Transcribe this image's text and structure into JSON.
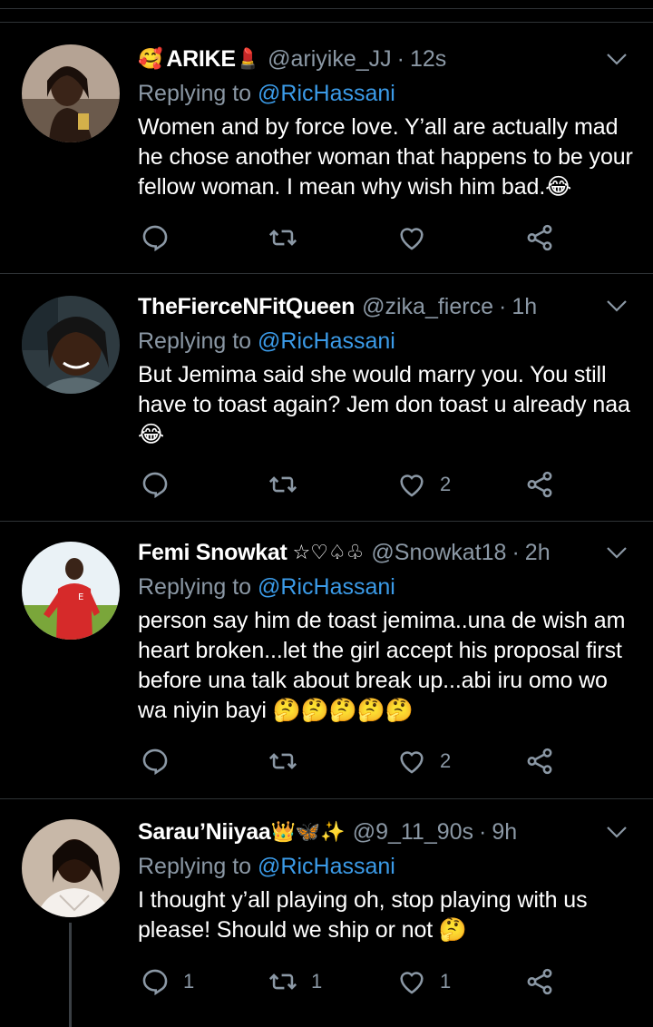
{
  "colors": {
    "background": "#000000",
    "text": "#ffffff",
    "muted": "#8b98a5",
    "link": "#3b9be8",
    "divider": "#2f3336"
  },
  "tweets": [
    {
      "name_prefix_emoji": "🥰",
      "name": "ARIKE",
      "name_suffix_emoji": "💄",
      "handle": "@ariyike_JJ",
      "time": "12s",
      "replying_label": "Replying to",
      "replying_to": "@RicHassani",
      "text": "Women and by force love. Y’all are actually mad he chose another woman that happens to be your fellow woman. I mean why wish him bad.😂",
      "reply_count": "",
      "retweet_count": "",
      "like_count": ""
    },
    {
      "name_prefix_emoji": "",
      "name": "TheFierceNFitQueen",
      "name_suffix_emoji": "",
      "handle": "@zika_fierce",
      "time": "1h",
      "replying_label": "Replying to",
      "replying_to": "@RicHassani",
      "text": "But Jemima said she would marry you. You still have to toast again? Jem don toast u already naa😂",
      "reply_count": "",
      "retweet_count": "",
      "like_count": "2"
    },
    {
      "name_prefix_emoji": "",
      "name": "Femi Snowkat",
      "name_suffix_emoji": "☆♡♤♧",
      "handle": "@Snowkat18",
      "time": "2h",
      "replying_label": "Replying to",
      "replying_to": "@RicHassani",
      "text": "person say him de toast jemima..una de wish am heart broken...let the girl accept his proposal first before una talk about break up...abi iru omo wo wa niyin bayi 🤔🤔🤔🤔🤔",
      "reply_count": "",
      "retweet_count": "",
      "like_count": "2"
    },
    {
      "name_prefix_emoji": "",
      "name": "Sarau’Niiyaa",
      "name_suffix_emoji": "👑🦋✨",
      "handle": "@9_11_90s",
      "time": "9h",
      "replying_label": "Replying to",
      "replying_to": "@RicHassani",
      "text": "I thought y’all playing oh, stop playing with us please! Should we ship or not 🤔",
      "reply_count": "1",
      "retweet_count": "1",
      "like_count": "1"
    }
  ],
  "icons": {
    "reply": "reply-icon",
    "retweet": "retweet-icon",
    "like": "heart-icon",
    "share": "share-icon",
    "more": "chevron-down-icon"
  }
}
